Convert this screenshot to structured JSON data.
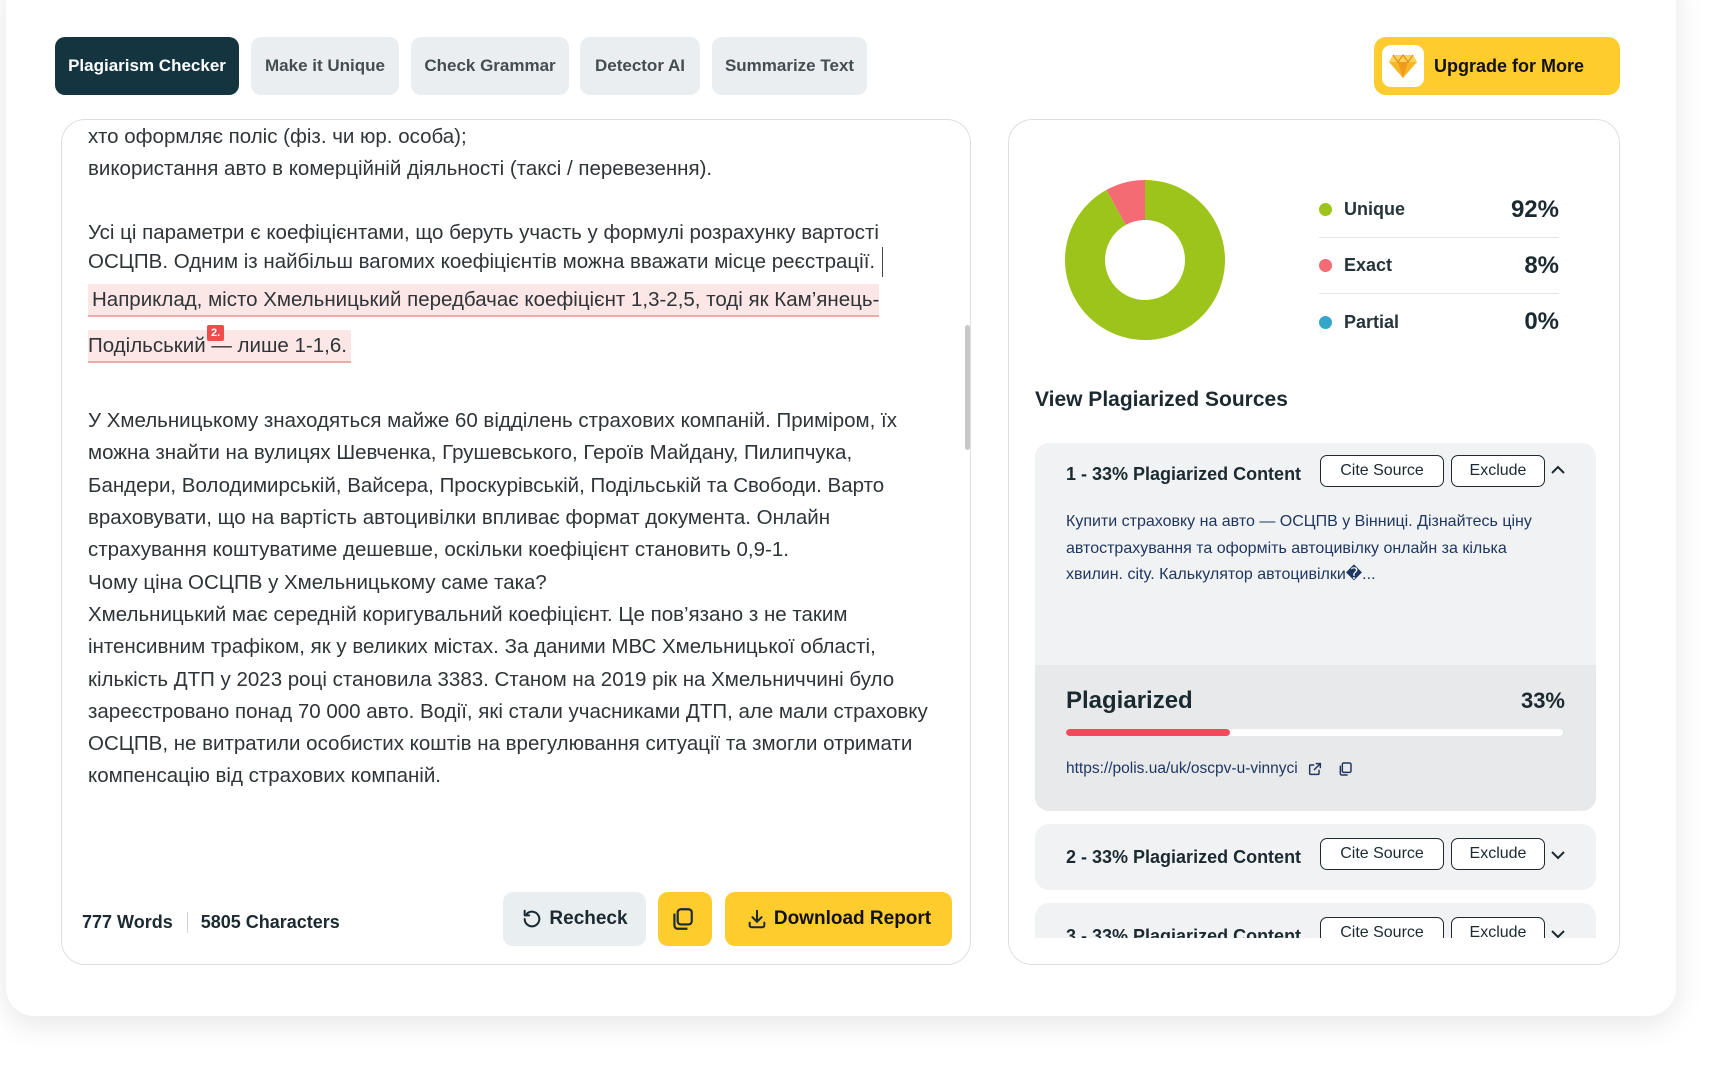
{
  "tabs": [
    {
      "label": "Plagiarism Checker",
      "active": true
    },
    {
      "label": "Make it Unique",
      "active": false
    },
    {
      "label": "Check Grammar",
      "active": false
    },
    {
      "label": "Detector AI",
      "active": false
    },
    {
      "label": "Summarize Text",
      "active": false
    }
  ],
  "upgrade": {
    "label": "Upgrade for More",
    "icon": "diamond-icon"
  },
  "editor": {
    "para1_line1": "хто оформляє поліс (фіз. чи юр. особа);",
    "para1_line2": "використання авто в комерційній діяльності (таксі / перевезення).",
    "para2_text": "Усі ці параметри є коефіцієнтами, що беруть участь у формулі розрахунку вартості ОСЦПВ. Одним із найбільш вагомих коефіцієнтів можна вважати місце реєстрації.",
    "marker": "2.",
    "highlight_text": "Наприклад, місто Хмельницький передбачає коефіцієнт 1,3-2,5, тоді як Кам’янець-Подільський — лише 1-1,6.",
    "para3": "У Хмельницькому знаходяться майже 60 відділень страхових компаній. Приміром, їх можна знайти на вулицях Шевченка, Грушевського, Героїв Майдану, Пилипчука, Бандери, Володимирській, Вайсера, Проскурівській, Подільській та Свободи. Варто враховувати, що на вартість автоцивілки впливає формат документа. Онлайн страхування коштуватиме дешевше, оскільки коефіцієнт становить 0,9-1.",
    "para4": "Чому ціна ОСЦПВ у Хмельницькому саме така?",
    "para5": "Хмельницький має середній коригувальний коефіцієнт. Це пов’язано з не таким інтенсивним трафіком, як у великих містах. За даними МВС Хмельницької області, кількість ДТП у 2023 році становила 3383. Станом на 2019 рік на Хмельниччині було зареєстровано понад 70 000 авто. Водії, які стали учасниками ДТП, але мали страховку ОСЦПВ, не витратили особистих коштів на врегулювання ситуації та змогли отримати компенсацію від страхових компаній."
  },
  "footer": {
    "words": "777 Words",
    "characters": "5805 Characters",
    "recheck_label": "Recheck",
    "download_label": "Download Report"
  },
  "summary": {
    "unique_label": "Unique",
    "unique_value": "92%",
    "unique_pct": 92,
    "exact_label": "Exact",
    "exact_value": "8%",
    "exact_pct": 8,
    "partial_label": "Partial",
    "partial_value": "0%",
    "partial_pct": 0,
    "colors": {
      "unique": "#9dc41a",
      "exact": "#f56b74",
      "partial": "#33a6c9"
    }
  },
  "sources_title": "View Plagiarized Sources",
  "sources": [
    {
      "title": "1 - 33% Plagiarized Content",
      "cite_label": "Cite Source",
      "exclude_label": "Exclude",
      "excerpt": "Купити страховку на авто — ОСЦПВ у Вінниці. Дізнайтесь ціну автострахування та оформіть автоцивілку онлайн за кілька хвилин. city. Калькулятор автоцивілки�...",
      "plag_label": "Plagiarized",
      "plag_value": "33%",
      "plag_pct": 33,
      "url": "https://polis.ua/uk/oscpv-u-vinnyci"
    },
    {
      "title": "2 - 33% Plagiarized Content",
      "cite_label": "Cite Source",
      "exclude_label": "Exclude"
    },
    {
      "title": "3 - 33% Plagiarized Content",
      "cite_label": "Cite Source",
      "exclude_label": "Exclude"
    }
  ]
}
